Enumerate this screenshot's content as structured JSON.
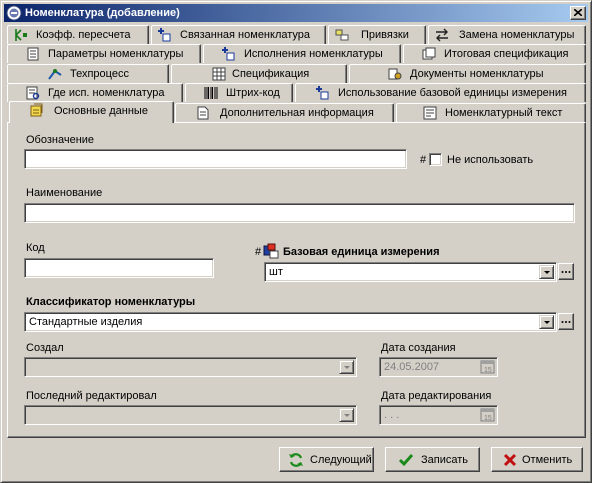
{
  "window": {
    "title": "Номенклатура (добавление)"
  },
  "tabs": {
    "row1": [
      "Коэфф. пересчета",
      "Связанная номенклатура",
      "Привязки",
      "Замена номенклатуры"
    ],
    "row2": [
      "Параметры номенклатуры",
      "Исполнения номенклатуры",
      "Итоговая спецификация"
    ],
    "row3": [
      "Техпроцесс",
      "Спецификация",
      "Документы номенклатуры"
    ],
    "row4": [
      "Где исп. номенклатура",
      "Штрих-код",
      "Использование базовой единицы измерения"
    ],
    "row5": [
      "Основные данные",
      "Дополнительная информация",
      "Номенклатурный текст"
    ]
  },
  "form": {
    "designation_label": "Обозначение",
    "designation_value": "",
    "hash_symbol": "#",
    "not_use_label": "Не использовать",
    "name_label": "Наименование",
    "name_value": "",
    "code_label": "Код",
    "code_value": "",
    "base_unit_label": "Базовая единица измерения",
    "base_unit_value": "шт",
    "classifier_label": "Классификатор номенклатуры",
    "classifier_value": "Стандартные изделия",
    "created_by_label": "Создал",
    "created_by_value": "",
    "created_date_label": "Дата создания",
    "created_date_value": "24.05.2007",
    "last_edited_by_label": "Последний редактировал",
    "last_edited_by_value": "",
    "edited_date_label": "Дата редактирования",
    "edited_date_value": ". . ."
  },
  "buttons": {
    "next": "Следующий",
    "save": "Записать",
    "cancel": "Отменить"
  }
}
